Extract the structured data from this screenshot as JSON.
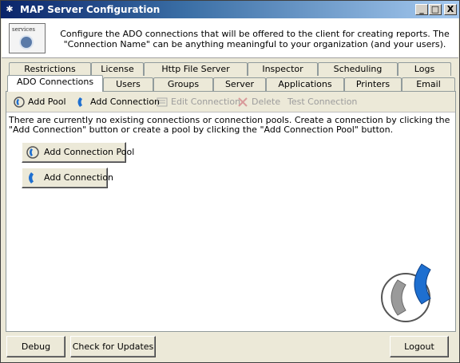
{
  "window": {
    "title": "MAP Server Configuration",
    "controls": {
      "minimize": "_",
      "maximize": "□",
      "close": "X"
    }
  },
  "header": {
    "description": "Configure the ADO connections that will be offered to the client for creating reports.  The \"Connection Name\" can be anything meaningful to your organization (and your users).",
    "logo_text": "services"
  },
  "tabs": {
    "row_back": [
      "Restrictions",
      "License",
      "Http File Server",
      "Inspector",
      "Scheduling",
      "Logs"
    ],
    "row_front": [
      "ADO Connections",
      "Users",
      "Groups",
      "Server",
      "Applications",
      "Printers",
      "Email"
    ],
    "selected": "ADO Connections"
  },
  "toolbar": {
    "add_pool": "Add Pool",
    "add_connection": "Add Connection",
    "edit_connection": "Edit Connection",
    "delete": "Delete",
    "test_connection": "Test Connection"
  },
  "main": {
    "message": "There are currently no existing connections or connection pools.  Create a connection by clicking the \"Add Connection\" button or create a pool by clicking the \"Add Connection Pool\" button.",
    "add_connection_pool_button": "Add Connection Pool",
    "add_connection_button": "Add Connection"
  },
  "footer": {
    "debug": "Debug",
    "check_updates": "Check for Updates",
    "logout": "Logout"
  },
  "colors": {
    "title_gradient_start": "#0a246a",
    "phone_blue": "#1e6fd0",
    "phone_gray": "#9a9a9a"
  }
}
